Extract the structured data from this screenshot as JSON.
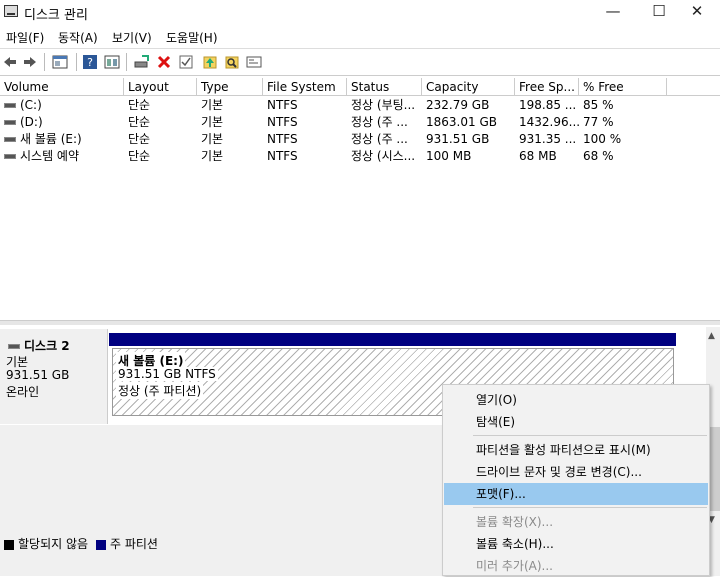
{
  "window": {
    "title": "디스크 관리",
    "min_glyph": "—",
    "max_glyph": "☐",
    "close_glyph": "✕"
  },
  "menu": [
    "파일(F)",
    "동작(A)",
    "보기(V)",
    "도움말(H)"
  ],
  "toolbar_icons": [
    "back-icon",
    "forward-icon",
    "properties-icon",
    "help-icon",
    "view-icon",
    "connect-drive-icon",
    "delete-icon",
    "check-icon",
    "up-icon",
    "search-icon",
    "settings-icon"
  ],
  "table": {
    "columns": [
      "Volume",
      "Layout",
      "Type",
      "File System",
      "Status",
      "Capacity",
      "Free Sp...",
      "% Free"
    ],
    "rows": [
      [
        "(C:)",
        "단순",
        "기본",
        "NTFS",
        "정상 (부팅...",
        "232.79 GB",
        "198.85 ...",
        "85 %"
      ],
      [
        "(D:)",
        "단순",
        "기본",
        "NTFS",
        "정상 (주 ...",
        "1863.01 GB",
        "1432.96...",
        "77 %"
      ],
      [
        "새 볼륨 (E:)",
        "단순",
        "기본",
        "NTFS",
        "정상 (주 ...",
        "931.51 GB",
        "931.35 ...",
        "100 %"
      ],
      [
        "시스템 예약",
        "단순",
        "기본",
        "NTFS",
        "정상 (시스...",
        "100 MB",
        "68 MB",
        "68 %"
      ]
    ]
  },
  "disk": {
    "name": "디스크 2",
    "type": "기본",
    "size": "931.51 GB",
    "status": "온라인",
    "partition": {
      "name": "새 볼륨  (E:)",
      "size_fs": "931.51 GB NTFS",
      "status": "정상 (주 파티션)"
    }
  },
  "legend": [
    {
      "label": "할당되지 않음",
      "color": "#000000"
    },
    {
      "label": "주 파티션",
      "color": "#000080"
    }
  ],
  "context_menu": {
    "items": [
      {
        "label": "열기(O)",
        "disabled": false,
        "highlighted": false
      },
      {
        "label": "탐색(E)",
        "disabled": false,
        "highlighted": false
      },
      {
        "label": "파티션을 활성 파티션으로 표시(M)",
        "disabled": false,
        "highlighted": false
      },
      {
        "label": "드라이브 문자 및 경로 변경(C)...",
        "disabled": false,
        "highlighted": false
      },
      {
        "label": "포맷(F)...",
        "disabled": false,
        "highlighted": true
      },
      {
        "label": "볼륨 확장(X)...",
        "disabled": true,
        "highlighted": false
      },
      {
        "label": "볼륨 축소(H)...",
        "disabled": false,
        "highlighted": false
      },
      {
        "label": "미러 추가(A)...",
        "disabled": true,
        "highlighted": false
      }
    ]
  }
}
